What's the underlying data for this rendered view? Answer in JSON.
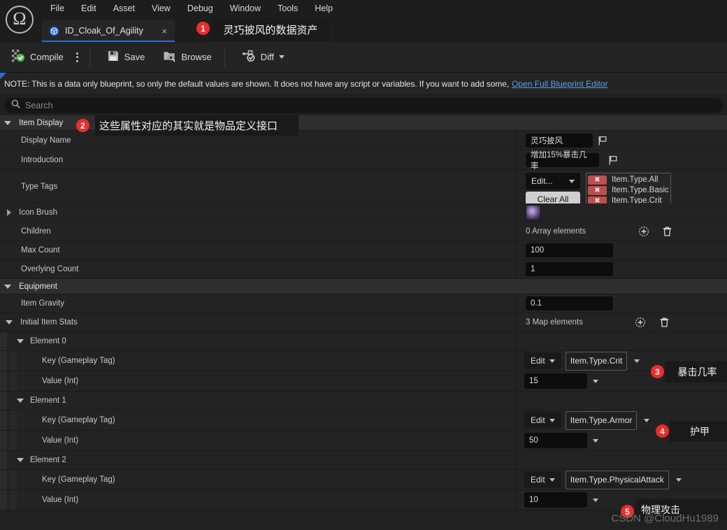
{
  "app": {
    "logo_icon": "unreal-engine-logo",
    "menu": [
      "File",
      "Edit",
      "Asset",
      "View",
      "Debug",
      "Window",
      "Tools",
      "Help"
    ]
  },
  "tab": {
    "icon": "blueprint-asset-icon",
    "label": "ID_Cloak_Of_Agility",
    "close": "×"
  },
  "toolbar": {
    "compile": "Compile",
    "compile_icon": "compile-check-icon",
    "kebab_icon": "more-options-icon",
    "save": "Save",
    "save_icon": "floppy-disk-icon",
    "browse": "Browse",
    "browse_icon": "folder-search-icon",
    "diff": "Diff",
    "diff_icon": "diff-check-icon"
  },
  "note": {
    "text": "NOTE: This is a data only blueprint, so only the default values are shown.  It does not have any script or variables.  If you want to add some,",
    "link": "Open Full Blueprint Editor"
  },
  "search": {
    "placeholder": "Search",
    "icon": "search-icon"
  },
  "details": {
    "categories": [
      {
        "name": "Item Display"
      },
      {
        "name": "Equipment"
      }
    ],
    "rows": {
      "display_name": {
        "label": "Display Name",
        "value": "灵巧披风"
      },
      "introduction": {
        "label": "Introduction",
        "value": "增加15%暴击几率"
      },
      "type_tags": {
        "label": "Type Tags",
        "edit_label": "Edit...",
        "clear_all": "Clear All",
        "tags": [
          "Item.Type.All",
          "Item.Type.Basic",
          "Item.Type.Crit"
        ],
        "remove_glyph": "✖"
      },
      "icon_brush": {
        "label": "Icon Brush",
        "thumb": "item-thumbnail"
      },
      "children": {
        "label": "Children",
        "value": "0 Array elements"
      },
      "max_count": {
        "label": "Max Count",
        "value": "100"
      },
      "overlying_count": {
        "label": "Overlying Count",
        "value": "1"
      },
      "item_gravity": {
        "label": "Item Gravity",
        "value": "0.1"
      },
      "initial_item_stats": {
        "label": "Initial Item Stats",
        "value": "3 Map elements"
      }
    },
    "array_icons": {
      "add": "add-element-icon",
      "delete": "delete-elements-icon"
    },
    "elements": [
      {
        "title": "Element 0",
        "key_label": "Key (Gameplay Tag)",
        "key_edit": "Edit",
        "key_value": "Item.Type.Crit",
        "value_label": "Value (Int)",
        "value": "15"
      },
      {
        "title": "Element 1",
        "key_label": "Key (Gameplay Tag)",
        "key_edit": "Edit",
        "key_value": "Item.Type.Armor",
        "value_label": "Value (Int)",
        "value": "50"
      },
      {
        "title": "Element 2",
        "key_label": "Key (Gameplay Tag)",
        "key_edit": "Edit",
        "key_value": "Item.Type.PhysicalAttack",
        "value_label": "Value (Int)",
        "value": "10"
      }
    ]
  },
  "annotations": [
    {
      "number": "1",
      "text": "灵巧披风的数据资产"
    },
    {
      "number": "2",
      "text": "这些属性对应的其实就是物品定义接口"
    },
    {
      "number": "3",
      "text": "暴击几率"
    },
    {
      "number": "4",
      "text": "护甲"
    },
    {
      "number": "5",
      "text": "物理攻击"
    }
  ],
  "watermark": "CSDN @CloudHu1989",
  "colors": {
    "accent_blue": "#2b6cd4",
    "badge_red": "#ef2b2b",
    "link_blue": "#5b9ee6",
    "tag_red": "#bf4f4f",
    "panel_bg": "#212121",
    "row_bg": "#232323",
    "category_bg": "#2e2e2e"
  }
}
